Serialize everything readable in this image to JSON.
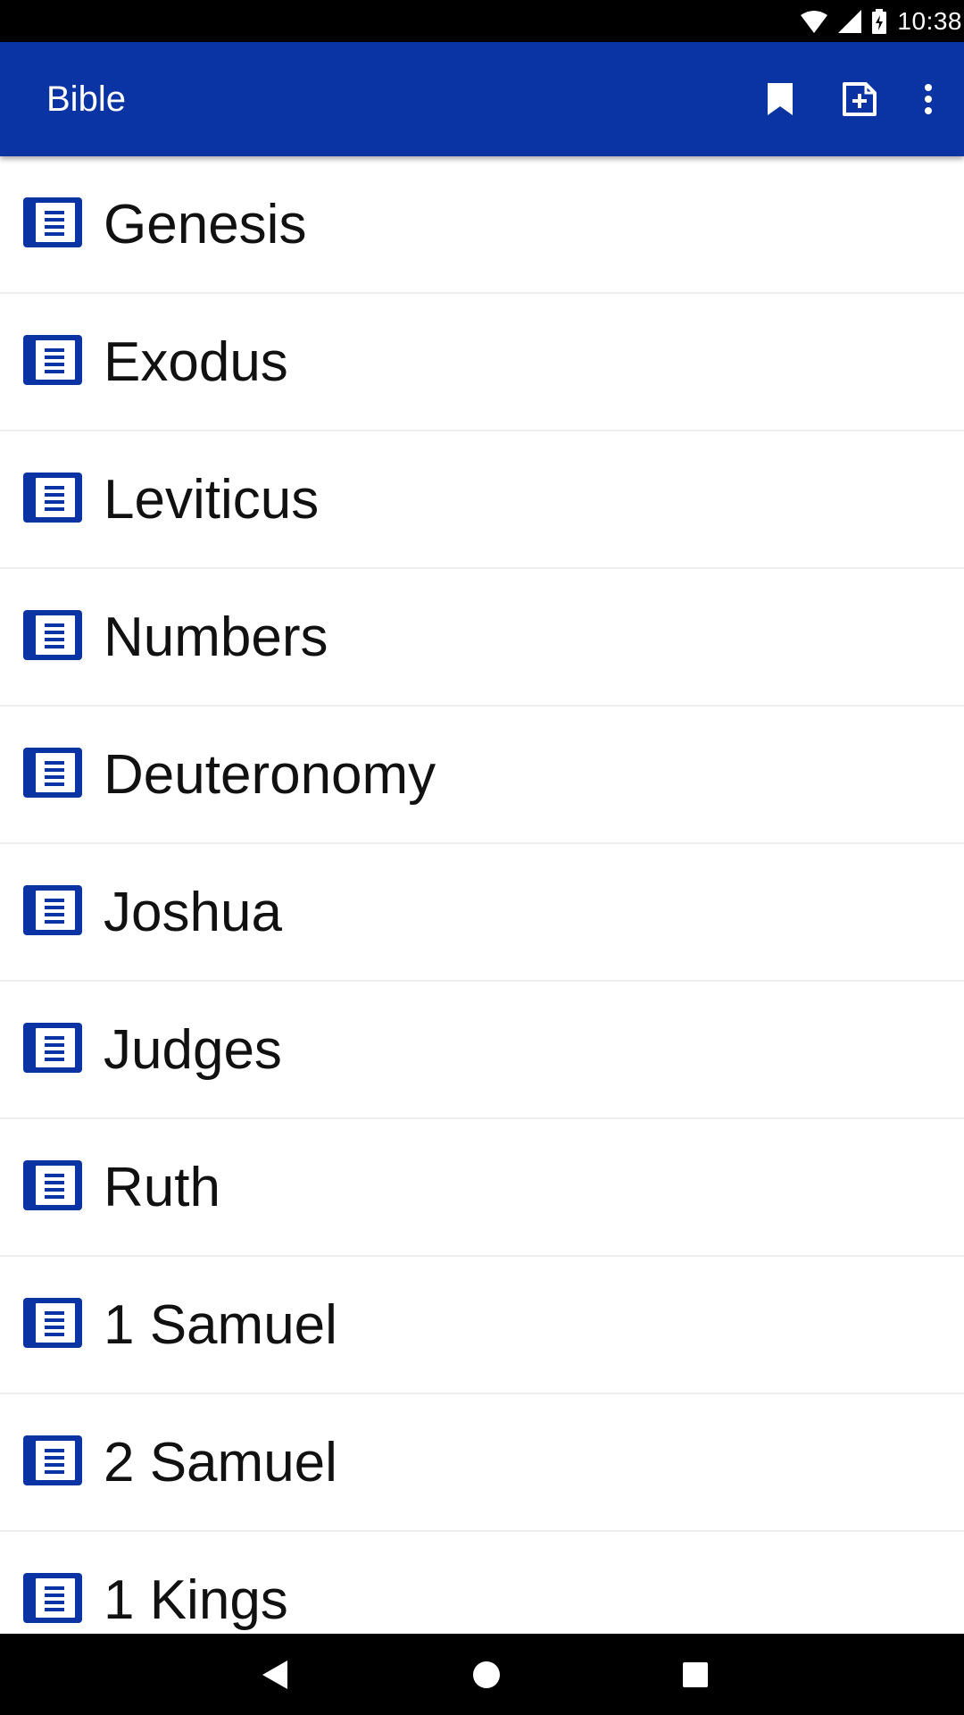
{
  "status_bar": {
    "time": "10:38",
    "icons": [
      "wifi-icon",
      "cell-signal-icon",
      "battery-icon"
    ]
  },
  "app_bar": {
    "title": "Bible",
    "actions": [
      "bookmark-icon",
      "add-note-icon",
      "more-options-icon"
    ]
  },
  "books": [
    {
      "label": "Genesis"
    },
    {
      "label": "Exodus"
    },
    {
      "label": "Leviticus"
    },
    {
      "label": "Numbers"
    },
    {
      "label": "Deuteronomy"
    },
    {
      "label": "Joshua"
    },
    {
      "label": "Judges"
    },
    {
      "label": "Ruth"
    },
    {
      "label": "1 Samuel"
    },
    {
      "label": "2 Samuel"
    },
    {
      "label": "1 Kings"
    }
  ],
  "nav_bar": {
    "buttons": [
      "back-icon",
      "home-icon",
      "recents-icon"
    ]
  },
  "colors": {
    "app_bar": "#0a33a3",
    "book_icon": "#0a33a3",
    "text": "#111111",
    "divider": "#eeeeee"
  }
}
